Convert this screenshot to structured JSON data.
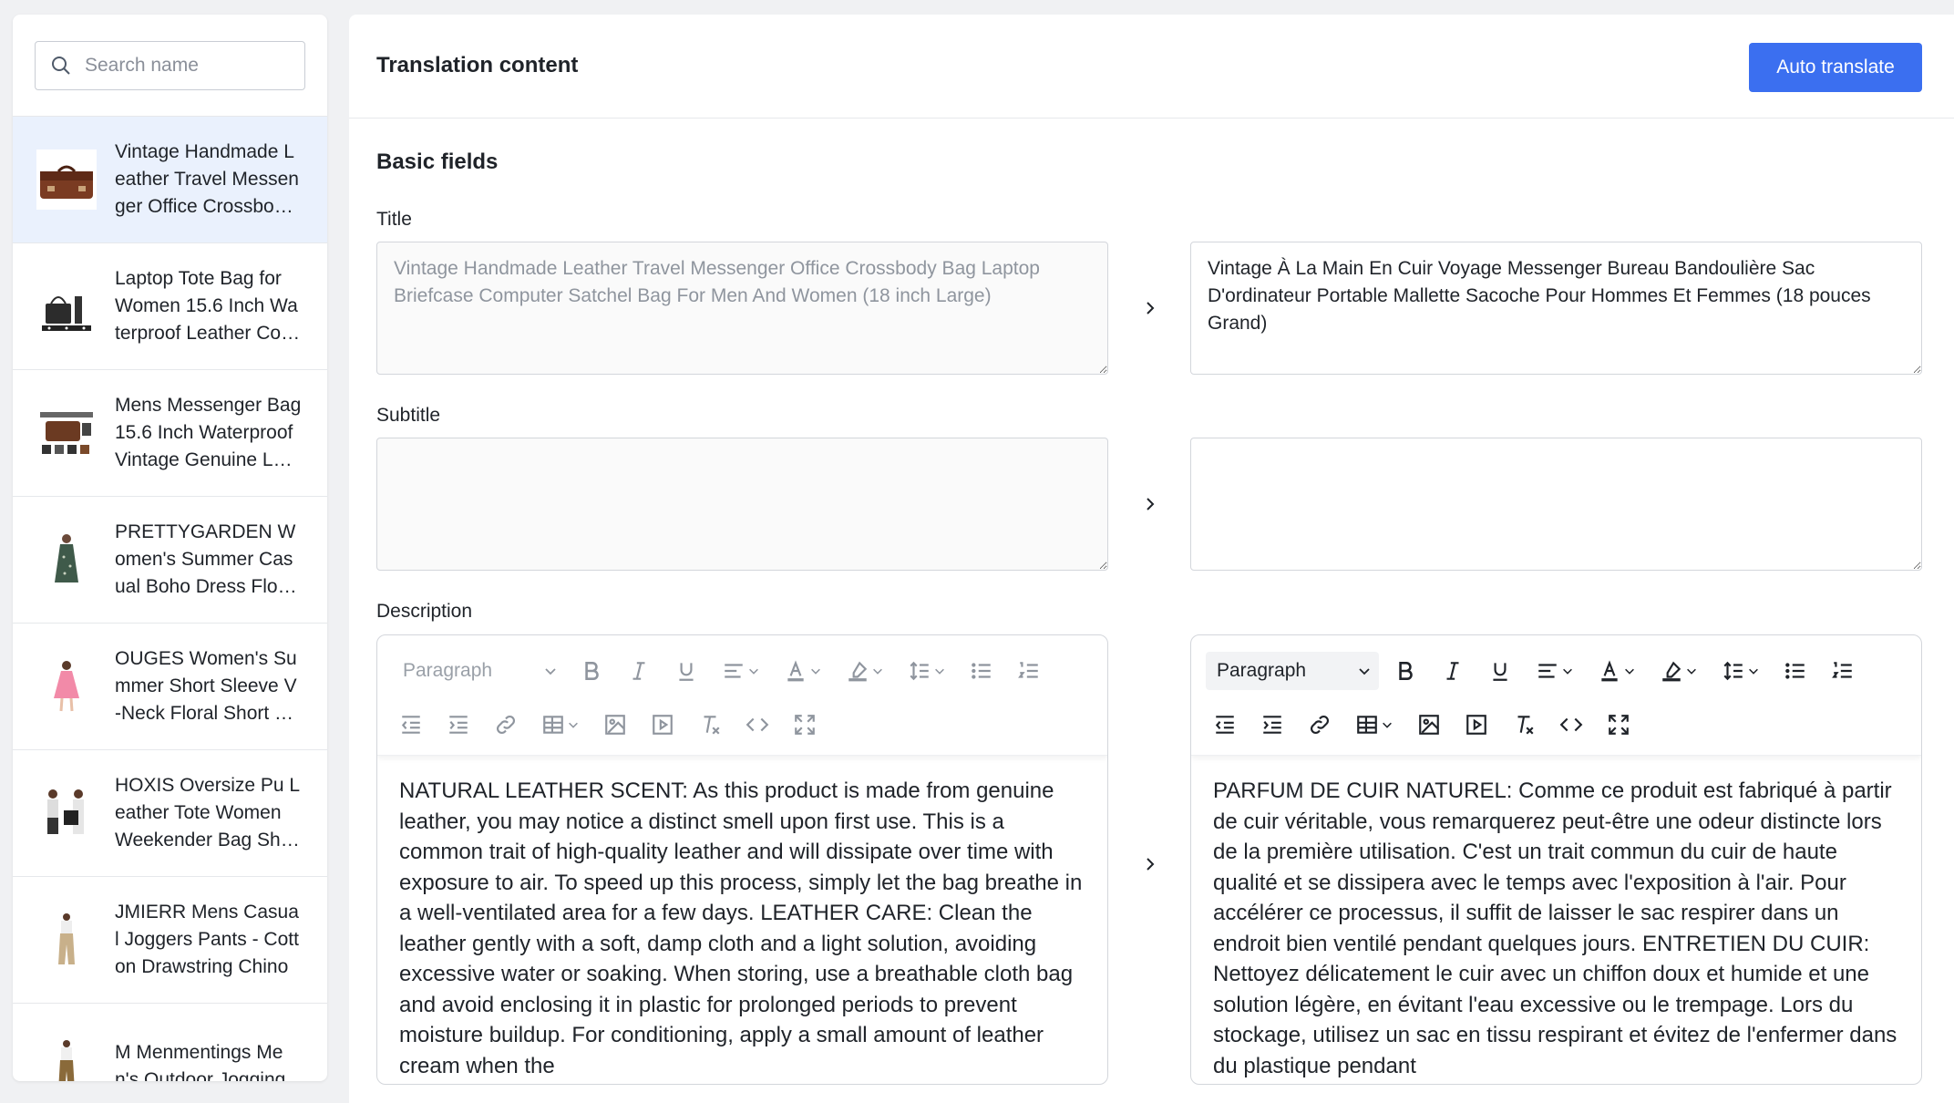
{
  "search": {
    "placeholder": "Search name"
  },
  "products": [
    {
      "name": "Vintage Handmade Leather Travel Messenger Office Crossbody Bag Laptop",
      "active": true
    },
    {
      "name": "Laptop Tote Bag for Women 15.6 Inch Waterproof Leather Computer Bag"
    },
    {
      "name": "Mens Messenger Bag 15.6 Inch Waterproof Vintage Genuine Leather"
    },
    {
      "name": "PRETTYGARDEN Women's Summer Casual Boho Dress Floral Print"
    },
    {
      "name": "OUGES Women's Summer Short Sleeve V-Neck Floral Short Dress"
    },
    {
      "name": "HOXIS Oversize Pu Leather Tote Women Weekender Bag Shoulder"
    },
    {
      "name": "JMIERR Mens Casual Joggers Pants - Cotton Drawstring Chino"
    },
    {
      "name": "M Menmentings Men's Outdoor Jogging"
    }
  ],
  "header": {
    "title": "Translation content",
    "auto_translate": "Auto translate"
  },
  "section": {
    "title": "Basic fields"
  },
  "fields": {
    "title_label": "Title",
    "title_source": "Vintage Handmade Leather Travel Messenger Office Crossbody Bag Laptop Briefcase Computer Satchel Bag For Men And Women (18 inch Large)",
    "title_target": "Vintage À La Main En Cuir Voyage Messenger Bureau Bandoulière Sac D'ordinateur Portable Mallette Sacoche Pour Hommes Et Femmes (18 pouces Grand)",
    "subtitle_label": "Subtitle",
    "subtitle_source": "",
    "subtitle_target": "",
    "description_label": "Description"
  },
  "editor": {
    "paragraph": "Paragraph"
  },
  "description": {
    "source": "NATURAL LEATHER SCENT: As this product is made from genuine leather, you may notice a distinct smell upon first use. This is a common trait of high-quality leather and will dissipate over time with exposure to air. To speed up this process, simply let the bag breathe in a well-ventilated area for a few days. LEATHER CARE: Clean the leather gently with a soft, damp cloth and a light solution, avoiding excessive water or soaking. When storing, use a breathable cloth bag and avoid enclosing it in plastic for prolonged periods to prevent moisture buildup. For conditioning, apply a small amount of leather cream when the",
    "target": "PARFUM DE CUIR NATUREL: Comme ce produit est fabriqué à partir de cuir véritable, vous remarquerez peut-être une odeur distincte lors de la première utilisation. C'est un trait commun du cuir de haute qualité et se dissipera avec le temps avec l'exposition à l'air. Pour accélérer ce processus, il suffit de laisser le sac respirer dans un endroit bien ventilé pendant quelques jours. ENTRETIEN DU CUIR: Nettoyez délicatement le cuir avec un chiffon doux et humide et une solution légère, en évitant l'eau excessive ou le trempage. Lors du stockage, utilisez un sac en tissu respirant et évitez de l'enfermer dans du plastique pendant"
  }
}
